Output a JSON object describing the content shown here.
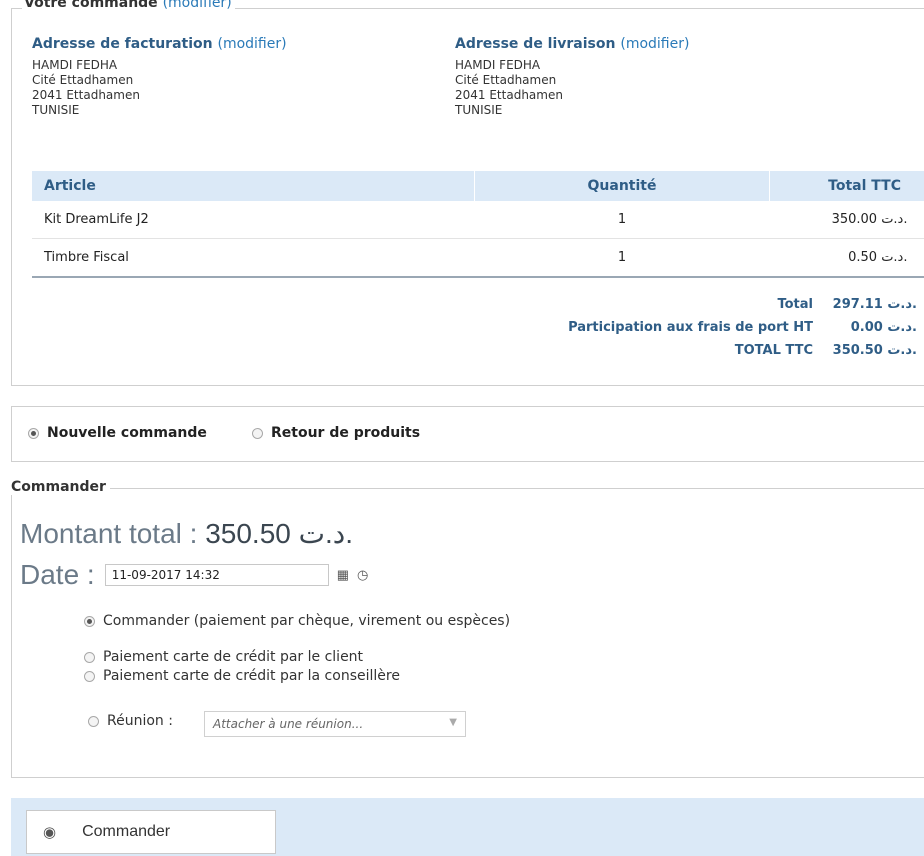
{
  "order": {
    "legend_title": "Votre commande",
    "legend_modify": "(modifier)",
    "billing": {
      "title": "Adresse de facturation",
      "modify": "(modifier)",
      "lines": [
        "HAMDI FEDHA",
        "Cité Ettadhamen",
        "2041 Ettadhamen",
        "TUNISIE"
      ]
    },
    "shipping": {
      "title": "Adresse de livraison",
      "modify": "(modifier)",
      "lines": [
        "HAMDI FEDHA",
        "Cité Ettadhamen",
        "2041 Ettadhamen",
        "TUNISIE"
      ]
    },
    "table": {
      "headers": [
        "Article",
        "Quantité",
        "Total TTC"
      ],
      "rows": [
        {
          "article": "Kit DreamLife J2",
          "qty": "1",
          "total": "350.00 د.ت."
        },
        {
          "article": "Timbre Fiscal",
          "qty": "1",
          "total": "0.50 د.ت."
        }
      ]
    },
    "totals": [
      {
        "label": "Total",
        "value": "297.11 د.ت."
      },
      {
        "label": "Participation aux frais de port HT",
        "value": "0.00 د.ت."
      },
      {
        "label": "TOTAL TTC",
        "value": "350.50 د.ت."
      }
    ]
  },
  "order_type": {
    "new_order": "Nouvelle commande",
    "return_products": "Retour de produits",
    "selected": "new_order"
  },
  "commander": {
    "legend": "Commander",
    "amount_label": "Montant total : ",
    "amount_value": "350.50 د.ت.",
    "date_label": "Date : ",
    "date_value": "11-09-2017 14:32",
    "payment_options": [
      "Commander (paiement par chèque, virement ou espèces)",
      "Paiement carte de crédit par le client",
      "Paiement carte de crédit par la conseillère"
    ],
    "meeting_label": "Réunion :",
    "meeting_placeholder": "Attacher à une réunion...",
    "selected_payment": 0
  },
  "bottom": {
    "submit_label": "Commander"
  },
  "colors": {
    "accent": "#2a7ab8",
    "header_bg": "#dbe9f7",
    "heading": "#2f5d86"
  }
}
